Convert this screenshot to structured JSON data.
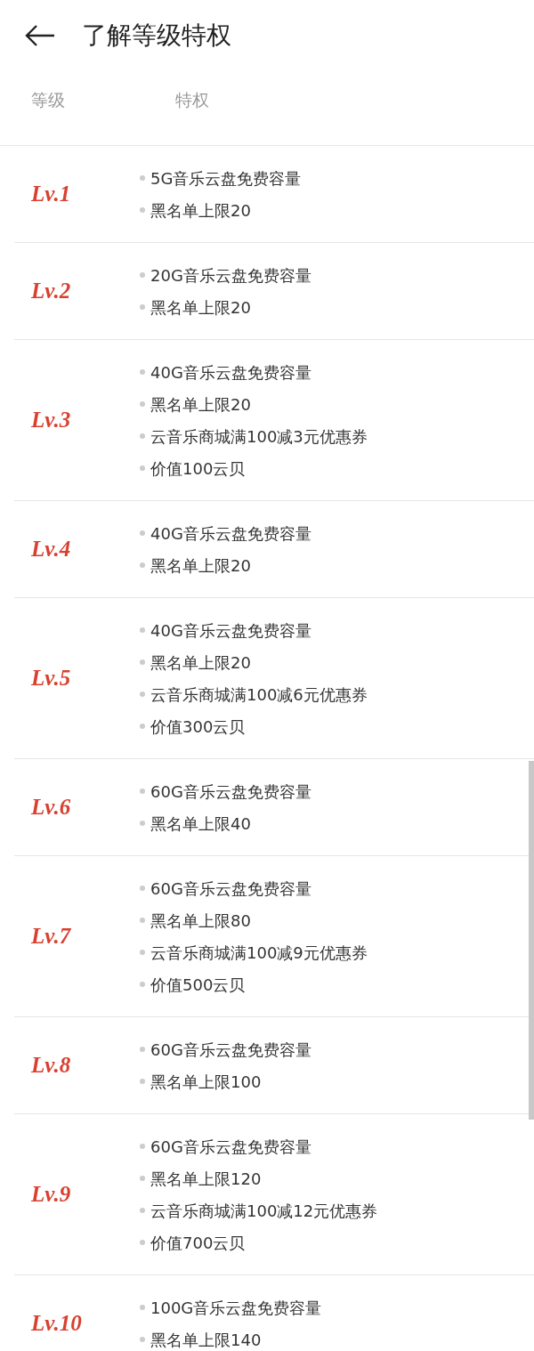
{
  "header": {
    "title": "了解等级特权"
  },
  "table": {
    "columns": [
      "等级",
      "特权"
    ],
    "rows": [
      {
        "level": "Lv.1",
        "perks": [
          "5G音乐云盘免费容量",
          "黑名单上限20"
        ]
      },
      {
        "level": "Lv.2",
        "perks": [
          "20G音乐云盘免费容量",
          "黑名单上限20"
        ]
      },
      {
        "level": "Lv.3",
        "perks": [
          "40G音乐云盘免费容量",
          "黑名单上限20",
          "云音乐商城满100减3元优惠券",
          "价值100云贝"
        ]
      },
      {
        "level": "Lv.4",
        "perks": [
          "40G音乐云盘免费容量",
          "黑名单上限20"
        ]
      },
      {
        "level": "Lv.5",
        "perks": [
          "40G音乐云盘免费容量",
          "黑名单上限20",
          "云音乐商城满100减6元优惠券",
          "价值300云贝"
        ]
      },
      {
        "level": "Lv.6",
        "perks": [
          "60G音乐云盘免费容量",
          "黑名单上限40"
        ]
      },
      {
        "level": "Lv.7",
        "perks": [
          "60G音乐云盘免费容量",
          "黑名单上限80",
          "云音乐商城满100减9元优惠券",
          "价值500云贝"
        ]
      },
      {
        "level": "Lv.8",
        "perks": [
          "60G音乐云盘免费容量",
          "黑名单上限100"
        ]
      },
      {
        "level": "Lv.9",
        "perks": [
          "60G音乐云盘免费容量",
          "黑名单上限120",
          "云音乐商城满100减12元优惠券",
          "价值700云贝"
        ]
      },
      {
        "level": "Lv.10",
        "perks": [
          "100G音乐云盘免费容量",
          "黑名单上限140"
        ]
      }
    ]
  }
}
